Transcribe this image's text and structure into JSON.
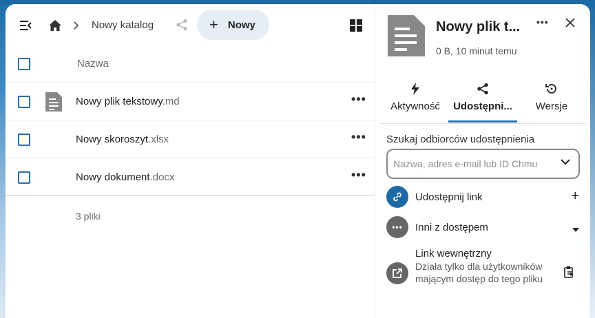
{
  "breadcrumb": {
    "folder": "Nowy katalog",
    "new_button": "Nowy"
  },
  "table": {
    "header_name": "Nazwa",
    "rows": [
      {
        "name": "Nowy plik tekstowy",
        "ext": ".md",
        "icon": "text-file-icon"
      },
      {
        "name": "Nowy skoroszyt",
        "ext": ".xlsx"
      },
      {
        "name": "Nowy dokument",
        "ext": ".docx"
      }
    ],
    "summary": "3 pliki"
  },
  "sidebar": {
    "title": "Nowy plik t...",
    "subtitle": "0 B, 10 minut temu",
    "tabs": [
      {
        "label": "Aktywność",
        "icon": "flash-icon"
      },
      {
        "label": "Udostępni...",
        "icon": "share-icon"
      },
      {
        "label": "Wersje",
        "icon": "history-icon"
      }
    ],
    "search_label": "Szukaj odbiorców udostępnienia",
    "search_placeholder": "Nazwa, adres e-mail lub ID Chmu",
    "share_link": "Udostępnij link",
    "others": "Inni z dostępem",
    "internal_title": "Link wewnętrzny",
    "internal_desc": "Działa tylko dla użytkowników mającym dostęp do tego pliku"
  },
  "colors": {
    "accent": "#2b6fa8",
    "link_avatar": "#1e6aa6",
    "grey_avatar": "#666666"
  }
}
